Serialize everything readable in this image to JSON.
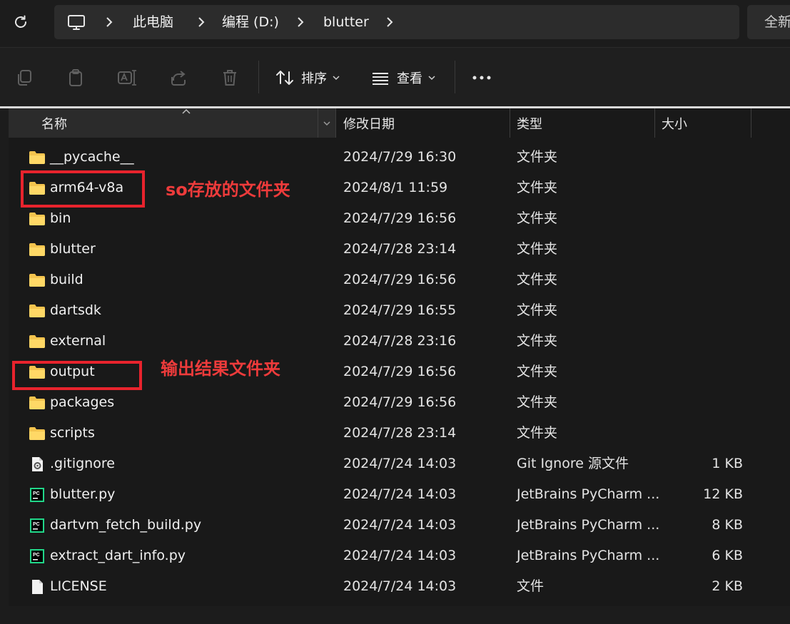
{
  "breadcrumb": {
    "items": [
      "此电脑",
      "编程 (D:)",
      "blutter"
    ]
  },
  "search": {
    "placeholder": "全新"
  },
  "toolbar": {
    "sort_label": "排序",
    "view_label": "查看",
    "more_label": "•••"
  },
  "columns": {
    "name": "名称",
    "date": "修改日期",
    "type": "类型",
    "size": "大小"
  },
  "files": [
    {
      "name": "__pycache__",
      "date": "2024/7/29 16:30",
      "type": "文件夹",
      "size": "",
      "icon": "folder-icon"
    },
    {
      "name": "arm64-v8a",
      "date": "2024/8/1 11:59",
      "type": "文件夹",
      "size": "",
      "icon": "folder-icon"
    },
    {
      "name": "bin",
      "date": "2024/7/29 16:56",
      "type": "文件夹",
      "size": "",
      "icon": "folder-icon"
    },
    {
      "name": "blutter",
      "date": "2024/7/28 23:14",
      "type": "文件夹",
      "size": "",
      "icon": "folder-icon"
    },
    {
      "name": "build",
      "date": "2024/7/29 16:56",
      "type": "文件夹",
      "size": "",
      "icon": "folder-icon"
    },
    {
      "name": "dartsdk",
      "date": "2024/7/29 16:55",
      "type": "文件夹",
      "size": "",
      "icon": "folder-icon"
    },
    {
      "name": "external",
      "date": "2024/7/28 23:16",
      "type": "文件夹",
      "size": "",
      "icon": "folder-icon"
    },
    {
      "name": "output",
      "date": "2024/7/29 16:56",
      "type": "文件夹",
      "size": "",
      "icon": "folder-icon"
    },
    {
      "name": "packages",
      "date": "2024/7/29 16:56",
      "type": "文件夹",
      "size": "",
      "icon": "folder-icon"
    },
    {
      "name": "scripts",
      "date": "2024/7/28 23:14",
      "type": "文件夹",
      "size": "",
      "icon": "folder-icon"
    },
    {
      "name": ".gitignore",
      "date": "2024/7/24 14:03",
      "type": "Git Ignore 源文件",
      "size": "1 KB",
      "icon": "gear-file-icon"
    },
    {
      "name": "blutter.py",
      "date": "2024/7/24 14:03",
      "type": "JetBrains PyCharm ...",
      "size": "12 KB",
      "icon": "pycharm-file-icon"
    },
    {
      "name": "dartvm_fetch_build.py",
      "date": "2024/7/24 14:03",
      "type": "JetBrains PyCharm ...",
      "size": "8 KB",
      "icon": "pycharm-file-icon"
    },
    {
      "name": "extract_dart_info.py",
      "date": "2024/7/24 14:03",
      "type": "JetBrains PyCharm ...",
      "size": "6 KB",
      "icon": "pycharm-file-icon"
    },
    {
      "name": "LICENSE",
      "date": "2024/7/24 14:03",
      "type": "文件",
      "size": "2 KB",
      "icon": "blank-file-icon"
    }
  ],
  "annotations": {
    "so_folder": "so存放的文件夹",
    "output_folder": "输出结果文件夹"
  },
  "colors": {
    "annotation_red": "#e8232d",
    "folder_yellow": "#f4c44e"
  }
}
